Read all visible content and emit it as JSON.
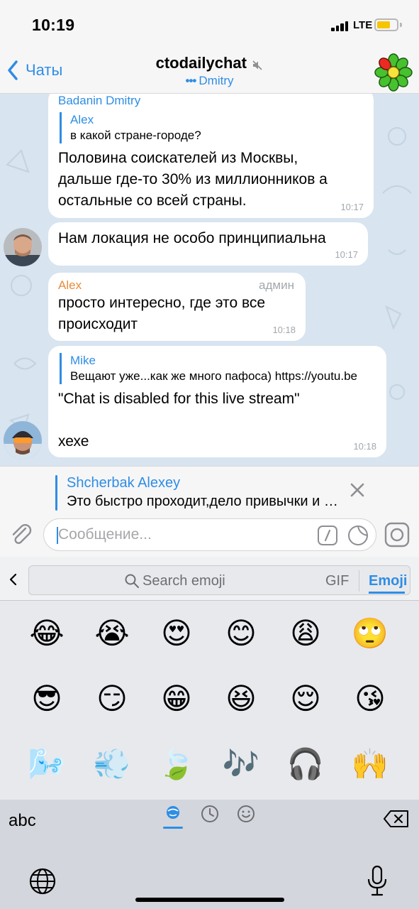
{
  "status_bar": {
    "time": "10:19",
    "network": "LTE"
  },
  "nav": {
    "back_label": "Чаты",
    "chat_title": "ctodailychat",
    "typing_dots": "•••",
    "typing_user": "Dmitry"
  },
  "messages": [
    {
      "sender": "Badanin Dmitry",
      "reply_name": "Alex",
      "reply_text": "в какой стране-городе?",
      "lines": [
        "Половина соискателей из Москвы,",
        "дальше где-то 30% из миллионников а",
        "остальные со всей страны."
      ],
      "time": "10:17"
    },
    {
      "lines": [
        "Нам локация не особо принципиальна"
      ],
      "time": "10:17"
    },
    {
      "sender": "Alex",
      "role": "админ",
      "lines": [
        "просто интересно, где это все",
        "происходит"
      ],
      "time": "10:18"
    },
    {
      "reply_name": "Mike",
      "reply_text": "Вещают уже...как же много пафоса) https://youtu.be",
      "lines": [
        "\"Chat is disabled for this live stream\"",
        "",
        "хехе"
      ],
      "time": "10:18"
    }
  ],
  "reply_preview": {
    "name": "Shcherbak Alexey",
    "text": "Это быстро проходит,дело привычки и опыта"
  },
  "input": {
    "placeholder": "Сообщение..."
  },
  "keyboard": {
    "search_placeholder": "Search emoji",
    "tab_gif": "GIF",
    "tab_emoji": "Emoji",
    "abc_label": "abc",
    "emojis": [
      [
        "😂",
        "😭",
        "😍",
        "😊",
        "😩",
        "🙄"
      ],
      [
        "😎",
        "😏",
        "😁",
        "😆",
        "😌",
        "😘"
      ],
      [
        "🌬️",
        "💨",
        "🍃",
        "🎶",
        "🎧",
        "🙌"
      ]
    ]
  },
  "colors": {
    "accent": "#2f8de4",
    "admin_name": "#e98b3a",
    "chat_background": "#d8e4ef",
    "bubble": "#ffffff",
    "battery": "#f7c400"
  },
  "icons": [
    "back-chevron-icon",
    "mute-icon",
    "icq-flower-icon",
    "close-icon",
    "attach-icon",
    "command-icon",
    "sticker-icon",
    "camera-icon",
    "search-icon",
    "emoji-category-icon",
    "recent-icon",
    "smiley-icon",
    "delete-icon",
    "globe-icon",
    "microphone-icon"
  ]
}
